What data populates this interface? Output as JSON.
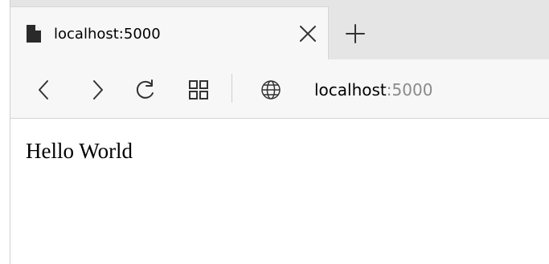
{
  "browser": {
    "tab": {
      "title": "localhost:5000",
      "icon": "document-icon",
      "close_icon": "close-icon"
    },
    "new_tab_icon": "plus-icon",
    "toolbar": {
      "back_icon": "chevron-left-icon",
      "forward_icon": "chevron-right-icon",
      "refresh_icon": "refresh-icon",
      "apps_icon": "grid-icon",
      "site_icon": "globe-icon"
    },
    "address": {
      "host": "localhost",
      "port": ":5000"
    }
  },
  "page": {
    "body_text": "Hello World"
  },
  "colors": {
    "tabstrip": "#e5e5e5",
    "toolbar": "#f7f7f7",
    "text": "#000000",
    "muted_text": "#8a8a8a",
    "border": "#d4d4d4"
  }
}
